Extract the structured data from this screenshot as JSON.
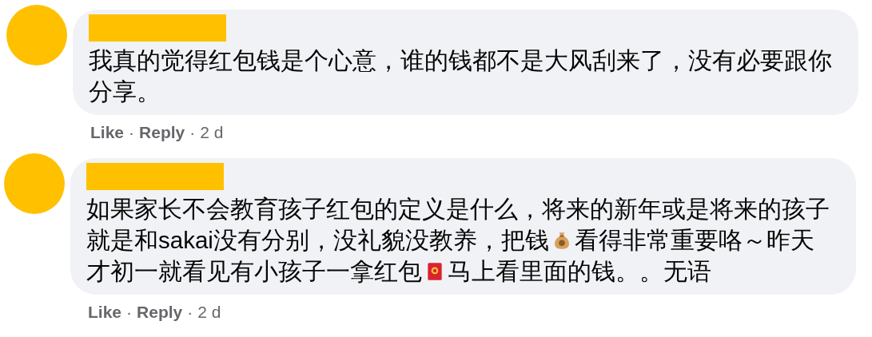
{
  "comments": [
    {
      "lines": [
        [
          {
            "kind": "text",
            "text": "我真的觉得红包钱是个心意，谁的钱都不是大风刮来了，没有必要跟你"
          }
        ],
        [
          {
            "kind": "text",
            "text": "分享。"
          }
        ]
      ],
      "actions": {
        "like": "Like",
        "sep1": "·",
        "reply": "Reply",
        "sep2": "·",
        "time": "2 d"
      }
    },
    {
      "lines": [
        [
          {
            "kind": "text",
            "text": "如果家长不会教育孩子红包的定义是什么，将来的新年或是将来的孩子"
          }
        ],
        [
          {
            "kind": "text",
            "text": "就是和sakai没有分别，没礼貌没教养，把钱"
          },
          {
            "kind": "money-bag"
          },
          {
            "kind": "text",
            "text": "看得非常重要咯～昨天"
          }
        ],
        [
          {
            "kind": "text",
            "text": "才初一就看见有小孩子一拿红包"
          },
          {
            "kind": "red-envelope"
          },
          {
            "kind": "text",
            "text": "马上看里面的钱。。无语"
          }
        ]
      ],
      "actions": {
        "like": "Like",
        "sep1": "·",
        "reply": "Reply",
        "sep2": "·",
        "time": "2 d"
      }
    }
  ]
}
